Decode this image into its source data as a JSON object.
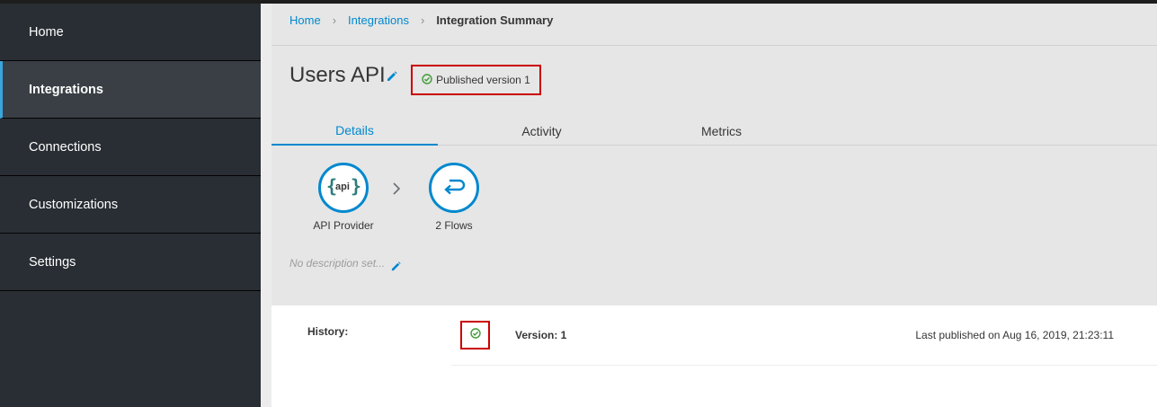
{
  "sidebar": {
    "items": [
      {
        "label": "Home"
      },
      {
        "label": "Integrations"
      },
      {
        "label": "Connections"
      },
      {
        "label": "Customizations"
      },
      {
        "label": "Settings"
      }
    ]
  },
  "breadcrumb": {
    "home": "Home",
    "integrations": "Integrations",
    "current": "Integration Summary",
    "separator": "›"
  },
  "integration": {
    "title": "Users API",
    "status": "Published version 1",
    "description_placeholder": "No description set..."
  },
  "tabs": [
    {
      "label": "Details"
    },
    {
      "label": "Activity"
    },
    {
      "label": "Metrics"
    }
  ],
  "flow": {
    "start": {
      "icon_text": "api",
      "label": "API Provider"
    },
    "end": {
      "label": "2 Flows"
    }
  },
  "history": {
    "label": "History:",
    "version": "Version: 1",
    "published": "Last published on Aug 16, 2019, 21:23:11"
  },
  "colors": {
    "accent": "#0088ce",
    "success": "#3f9c35",
    "highlight": "#cc0000",
    "sidebar_bg": "#292e34"
  },
  "icons": {
    "title_edit": "pencil-icon",
    "status": "check-circle-icon",
    "api": "api-icon",
    "flows": "return-arrow-icon",
    "chevron": "chevron-right-icon",
    "description_edit": "pencil-icon",
    "history_status": "check-circle-icon"
  }
}
